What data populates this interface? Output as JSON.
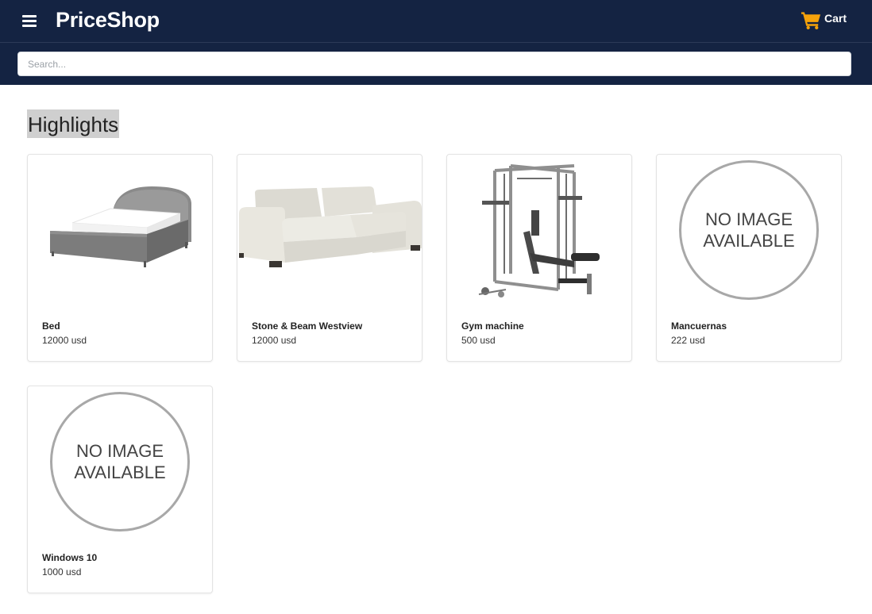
{
  "header": {
    "brand": "PriceShop",
    "cart_label": "Cart",
    "accent": "#f5a20a",
    "background": "#142342"
  },
  "search": {
    "placeholder": "Search...",
    "value": ""
  },
  "main": {
    "section_title": "Highlights",
    "products": [
      {
        "name": "Bed",
        "price": "12000 usd",
        "image": "bed-image"
      },
      {
        "name": "Stone & Beam Westview",
        "price": "12000 usd",
        "image": "sofa-image"
      },
      {
        "name": "Gym machine",
        "price": "500 usd",
        "image": "gym-machine-image"
      },
      {
        "name": "Mancuernas",
        "price": "222 usd",
        "image": "no-image",
        "placeholder": "NO IMAGE AVAILABLE"
      },
      {
        "name": "Windows 10",
        "price": "1000 usd",
        "image": "no-image",
        "placeholder": "NO IMAGE AVAILABLE"
      }
    ]
  }
}
